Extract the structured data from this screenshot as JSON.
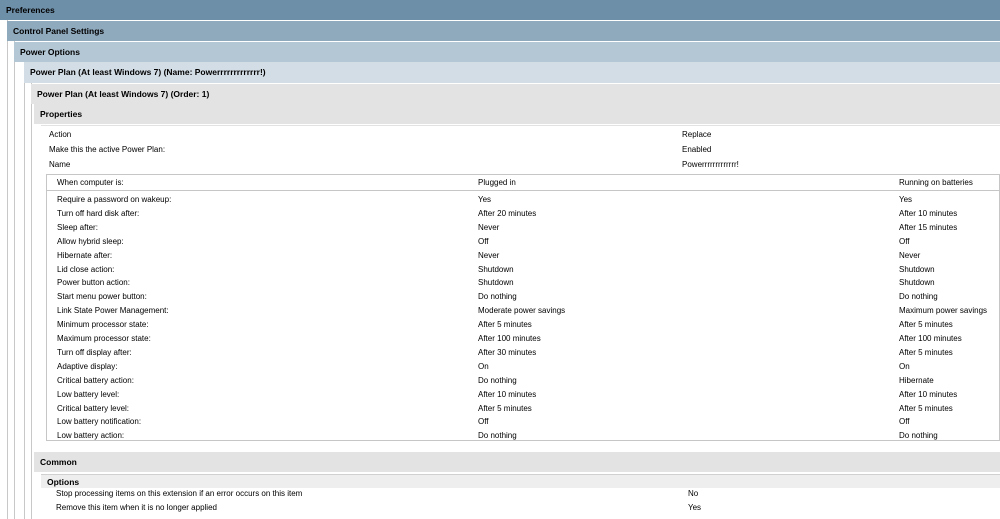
{
  "sections": {
    "preferences": "Preferences",
    "control_panel": "Control Panel Settings",
    "power_options": "Power Options",
    "power_plan_name": "Power Plan (At least Windows 7) (Name: Powerrrrrrrrrrrrr!)",
    "power_plan_order": "Power Plan (At least Windows 7) (Order: 1)",
    "properties": "Properties",
    "common": "Common",
    "options": "Options"
  },
  "properties": [
    {
      "label": "Action",
      "value": "Replace"
    },
    {
      "label": "Make this the active Power Plan:",
      "value": "Enabled"
    },
    {
      "label": "Name",
      "value": "Powerrrrrrrrrrrrr!"
    }
  ],
  "table": {
    "headers": [
      "When computer is:",
      "Plugged in",
      "Running on batteries"
    ],
    "rows": [
      [
        "Require a password on wakeup:",
        "Yes",
        "Yes"
      ],
      [
        "Turn off hard disk after:",
        "After 20 minutes",
        "After 10 minutes"
      ],
      [
        "Sleep after:",
        "Never",
        "After 15 minutes"
      ],
      [
        "Allow hybrid sleep:",
        "Off",
        "Off"
      ],
      [
        "Hibernate after:",
        "Never",
        "Never"
      ],
      [
        "Lid close action:",
        "Shutdown",
        "Shutdown"
      ],
      [
        "Power button action:",
        "Shutdown",
        "Shutdown"
      ],
      [
        "Start menu power button:",
        "Do nothing",
        "Do nothing"
      ],
      [
        "Link State Power Management:",
        "Moderate power savings",
        "Maximum power savings"
      ],
      [
        "Minimum processor state:",
        "After 5 minutes",
        "After 5 minutes"
      ],
      [
        "Maximum processor state:",
        "After 100 minutes",
        "After 100 minutes"
      ],
      [
        "Turn off display after:",
        "After 30 minutes",
        "After 5 minutes"
      ],
      [
        "Adaptive display:",
        "On",
        "On"
      ],
      [
        "Critical battery action:",
        "Do nothing",
        "Hibernate"
      ],
      [
        "Low battery level:",
        "After 10 minutes",
        "After 10 minutes"
      ],
      [
        "Critical battery level:",
        "After 5 minutes",
        "After 5 minutes"
      ],
      [
        "Low battery notification:",
        "Off",
        "Off"
      ],
      [
        "Low battery action:",
        "Do nothing",
        "Do nothing"
      ]
    ]
  },
  "options": [
    {
      "label": "Stop processing items on this extension if an error occurs on this item",
      "value": "No"
    },
    {
      "label": "Remove this item when it is no longer applied",
      "value": "Yes"
    }
  ]
}
